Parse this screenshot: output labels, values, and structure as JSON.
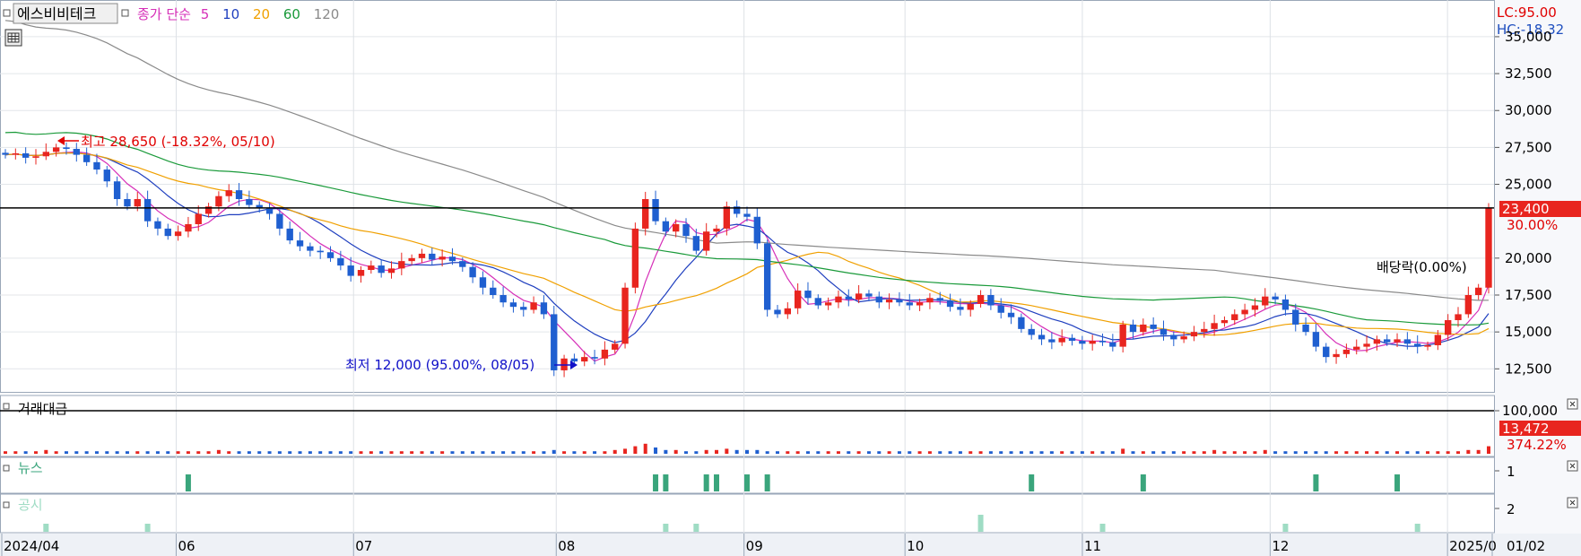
{
  "header": {
    "stock_name": "에스비비테크",
    "ma_prefix": "종가 단순",
    "ma_periods": [
      "5",
      "10",
      "20",
      "60",
      "120"
    ],
    "ma_colors": [
      "#d62fb8",
      "#1f3fbf",
      "#f0a000",
      "#1a9a3a",
      "#8a8a8a"
    ],
    "lc_label": "LC:95.00",
    "hc_label": "HC:-18.32",
    "lc_color": "#e00000",
    "hc_color": "#1f4fbf"
  },
  "annotations": {
    "high": "최고 28,650 (-18.32%, 05/10)",
    "low": "최저 12,000 (95.00%, 08/05)",
    "dividend": "배당락(0.00%)"
  },
  "price_axis": {
    "ticks": [
      "35,000",
      "32,500",
      "30,000",
      "27,500",
      "25,000",
      "20,000",
      "17,500",
      "15,000",
      "12,500"
    ],
    "current_price": "23,400",
    "current_pct": "30.00%"
  },
  "volume_panel": {
    "title": "거래대금",
    "tick": "100,000",
    "current_value": "13,472",
    "current_pct": "374.22%"
  },
  "news_panel": {
    "title": "뉴스",
    "tick": "1"
  },
  "disclosure_panel": {
    "title": "공시",
    "tick": "2"
  },
  "x_axis": {
    "labels": [
      "2024/04",
      "06",
      "07",
      "08",
      "09",
      "10",
      "11",
      "12",
      "2025/0",
      "01/02"
    ]
  },
  "colors": {
    "up": "#e8251f",
    "down": "#1f5fd0",
    "news": "#3aa57c",
    "disclosure": "#9fdcc4"
  },
  "chart_data": {
    "type": "candlestick",
    "x_start": "2024/04",
    "x_end": "2025/01/02",
    "y_axis": {
      "min": 11000,
      "max": 37000
    },
    "moving_average_periods": [
      5,
      10,
      20,
      60,
      120
    ],
    "key_points": {
      "high": {
        "price": 28650,
        "pct": -18.32,
        "date": "05/10"
      },
      "low": {
        "price": 12000,
        "pct": 95.0,
        "date": "08/05"
      },
      "last_close": 23400,
      "horizontal_line": 23400
    },
    "close_series": [
      27000,
      27100,
      26800,
      26900,
      27200,
      27500,
      27400,
      27000,
      26500,
      26000,
      25200,
      24000,
      23500,
      24000,
      22500,
      22000,
      21500,
      21800,
      22300,
      23000,
      23500,
      24200,
      24600,
      24000,
      23600,
      23400,
      23000,
      22000,
      21200,
      20800,
      20500,
      20400,
      20000,
      19500,
      18800,
      19200,
      19500,
      19000,
      19300,
      19800,
      20000,
      20300,
      19900,
      20100,
      19800,
      19400,
      18700,
      18000,
      17500,
      17000,
      16700,
      16500,
      17000,
      16200,
      12400,
      13200,
      13000,
      13300,
      13200,
      13800,
      14200,
      18000,
      22000,
      24000,
      22500,
      21800,
      22300,
      21500,
      20500,
      21800,
      22000,
      23500,
      23000,
      22800,
      21000,
      16500,
      16200,
      16600,
      17800,
      17300,
      16800,
      17000,
      17400,
      17200,
      17600,
      17400,
      17000,
      17200,
      17000,
      16800,
      17000,
      17300,
      17100,
      16700,
      16500,
      16900,
      17500,
      16800,
      16300,
      16000,
      15200,
      14800,
      14500,
      14300,
      14600,
      14400,
      14200,
      14400,
      14300,
      14000,
      15500,
      15000,
      15500,
      15200,
      14800,
      14500,
      14700,
      15000,
      15200,
      15600,
      15800,
      16200,
      16500,
      16800,
      17400,
      17200,
      16500,
      15500,
      15000,
      14000,
      13300,
      13500,
      13800,
      14000,
      14200,
      14500,
      14300,
      14500,
      14200,
      14000,
      14100,
      14800,
      15800,
      16200,
      17500,
      18000,
      23400
    ],
    "volume_series": [
      2,
      2,
      2,
      2,
      3,
      2,
      2,
      2,
      2,
      2,
      2,
      2,
      2,
      2,
      2,
      2,
      2,
      2,
      2,
      2,
      2,
      3,
      2,
      2,
      2,
      2,
      2,
      2,
      2,
      2,
      2,
      2,
      2,
      2,
      2,
      2,
      2,
      2,
      2,
      2,
      2,
      2,
      2,
      2,
      2,
      2,
      2,
      2,
      2,
      2,
      2,
      2,
      2,
      2,
      3,
      2,
      2,
      2,
      2,
      2,
      3,
      4,
      6,
      8,
      5,
      3,
      3,
      2,
      2,
      3,
      3,
      4,
      3,
      3,
      3,
      2,
      2,
      2,
      2,
      2,
      2,
      2,
      2,
      2,
      2,
      2,
      2,
      2,
      2,
      2,
      2,
      2,
      2,
      2,
      2,
      2,
      2,
      2,
      2,
      2,
      2,
      2,
      2,
      2,
      2,
      2,
      2,
      2,
      2,
      2,
      4,
      2,
      2,
      2,
      2,
      2,
      2,
      2,
      2,
      3,
      2,
      2,
      2,
      2,
      3,
      2,
      2,
      2,
      2,
      2,
      2,
      2,
      2,
      2,
      2,
      2,
      2,
      2,
      2,
      2,
      2,
      2,
      2,
      2,
      3,
      3,
      6
    ],
    "news_events": [
      18,
      64,
      65,
      69,
      70,
      73,
      75,
      101,
      112,
      129,
      137
    ],
    "disclosure_events": [
      4,
      14,
      65,
      68,
      96,
      108,
      126,
      139
    ]
  }
}
